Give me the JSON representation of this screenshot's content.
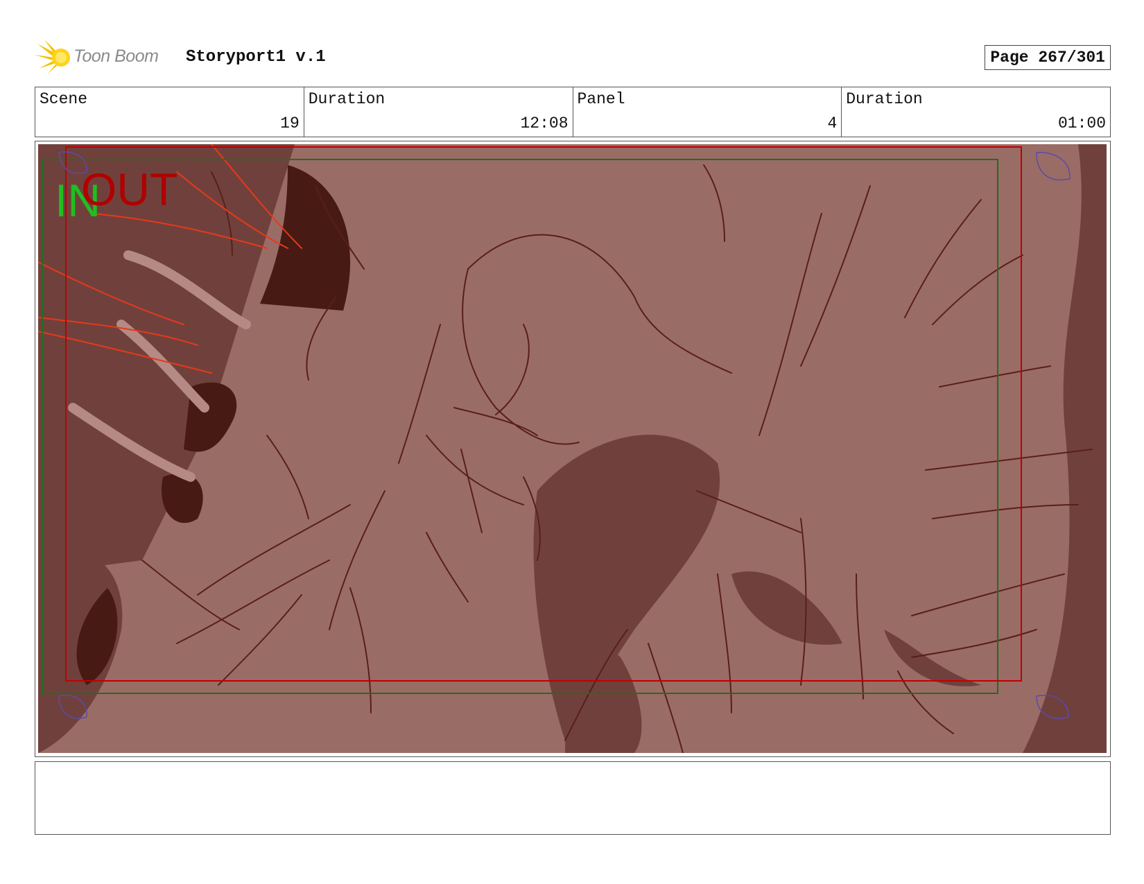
{
  "header": {
    "logo_text": "Toon Boom",
    "project_title": "Storyport1 v.1",
    "page_label": "Page 267/301"
  },
  "info": [
    {
      "label": "Scene",
      "value": "19"
    },
    {
      "label": "Duration",
      "value": "12:08"
    },
    {
      "label": "Panel",
      "value": "4"
    },
    {
      "label": "Duration",
      "value": "01:00"
    }
  ],
  "panel": {
    "in_label": "IN",
    "out_label": "OUT",
    "colors": {
      "background": "#9a6c66",
      "shadow": "#6e3f3a",
      "dark": "#481a14",
      "line": "#5a1e1a",
      "speed_lines": "#e8381a",
      "in_frame": "#1f6e1f",
      "out_frame": "#c00000"
    }
  },
  "notes": {
    "text": ""
  }
}
